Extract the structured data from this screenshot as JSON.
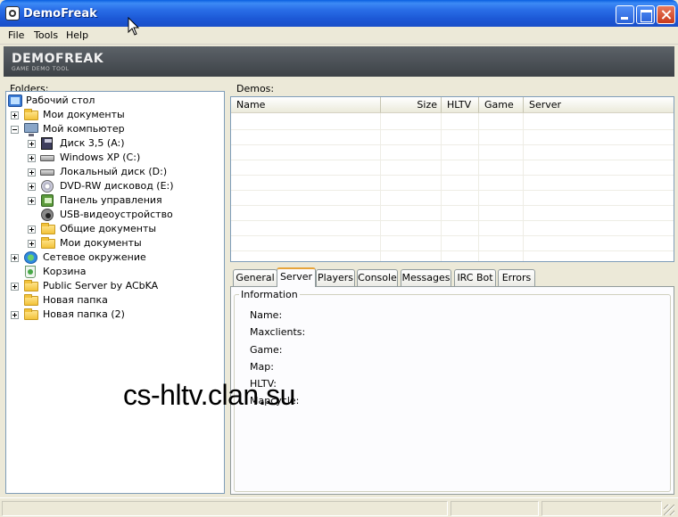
{
  "window": {
    "title": "DemoFreak",
    "icon": "demofreak-app-icon"
  },
  "menu": {
    "items": [
      "File",
      "Tools",
      "Help"
    ]
  },
  "banner": {
    "title": "DEMOFREAK",
    "subtitle": "GAME DEMO TOOL",
    "bg_color": "#4a4f55"
  },
  "folders": {
    "label": "Folders:",
    "items": [
      {
        "label": "Рабочий стол",
        "icon": "desktop-icon",
        "depth": 0,
        "expander": "none"
      },
      {
        "label": "Мои документы",
        "icon": "folder-icon",
        "depth": 1,
        "expander": "plus"
      },
      {
        "label": "Мой компьютер",
        "icon": "computer-icon",
        "depth": 1,
        "expander": "minus"
      },
      {
        "label": "Диск 3,5 (A:)",
        "icon": "floppy-icon",
        "depth": 2,
        "expander": "plus"
      },
      {
        "label": "Windows XP (C:)",
        "icon": "hard-drive-icon",
        "depth": 2,
        "expander": "plus"
      },
      {
        "label": "Локальный диск (D:)",
        "icon": "hard-drive-icon",
        "depth": 2,
        "expander": "plus"
      },
      {
        "label": "DVD-RW дисковод (E:)",
        "icon": "dvd-drive-icon",
        "depth": 2,
        "expander": "plus"
      },
      {
        "label": "Панель управления",
        "icon": "control-panel-icon",
        "depth": 2,
        "expander": "plus"
      },
      {
        "label": "USB-видеоустройство",
        "icon": "usb-camera-icon",
        "depth": 2,
        "expander": "none"
      },
      {
        "label": "Общие документы",
        "icon": "folder-icon",
        "depth": 2,
        "expander": "plus"
      },
      {
        "label": "Мои документы",
        "icon": "folder-icon",
        "depth": 2,
        "expander": "plus"
      },
      {
        "label": "Сетевое окружение",
        "icon": "network-icon",
        "depth": 1,
        "expander": "plus"
      },
      {
        "label": "Корзина",
        "icon": "recycle-bin-icon",
        "depth": 1,
        "expander": "none"
      },
      {
        "label": "Public Server by ACbKA",
        "icon": "folder-icon",
        "depth": 1,
        "expander": "plus"
      },
      {
        "label": "Новая папка",
        "icon": "folder-icon",
        "depth": 1,
        "expander": "none"
      },
      {
        "label": "Новая папка (2)",
        "icon": "folder-icon",
        "depth": 1,
        "expander": "plus"
      }
    ]
  },
  "demos": {
    "label": "Demos:",
    "columns": [
      "Name",
      "Size",
      "HLTV",
      "Game",
      "Server"
    ],
    "rows": []
  },
  "tabs": {
    "items": [
      "General",
      "Server",
      "Players",
      "Console",
      "Messages",
      "IRC Bot",
      "Errors"
    ],
    "active": "Server"
  },
  "server_info": {
    "group_title": "Information",
    "fields": [
      "Name:",
      "Maxclients:",
      "Game:",
      "Map:",
      "HLTV:",
      "Mapcycle:"
    ]
  },
  "watermark": "cs-hltv.clan.su"
}
